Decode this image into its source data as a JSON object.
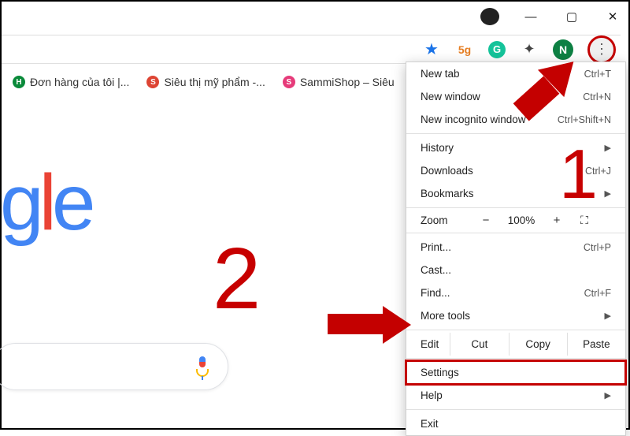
{
  "titlebar": {
    "min": "—",
    "max": "▢",
    "close": "✕"
  },
  "addrbar": {
    "star": "★",
    "avatar_letter": "N"
  },
  "bookmarks": [
    {
      "icon_class": "fv-green",
      "icon_text": "H",
      "label": "Đơn hàng của tôi |..."
    },
    {
      "icon_class": "fv-red",
      "icon_text": "S",
      "label": "Siêu thị mỹ phẩm -..."
    },
    {
      "icon_class": "fv-pink",
      "icon_text": "S",
      "label": "SammiShop – Siêu"
    }
  ],
  "menu": {
    "new_tab": {
      "label": "New tab",
      "shortcut": "Ctrl+T"
    },
    "new_window": {
      "label": "New window",
      "shortcut": "Ctrl+N"
    },
    "incognito": {
      "label": "New incognito window",
      "shortcut": "Ctrl+Shift+N"
    },
    "history": {
      "label": "History"
    },
    "downloads": {
      "label": "Downloads",
      "shortcut": "Ctrl+J"
    },
    "bookmarks": {
      "label": "Bookmarks"
    },
    "zoom": {
      "label": "Zoom",
      "level": "100%"
    },
    "print": {
      "label": "Print...",
      "shortcut": "Ctrl+P"
    },
    "cast": {
      "label": "Cast..."
    },
    "find": {
      "label": "Find...",
      "shortcut": "Ctrl+F"
    },
    "more_tools": {
      "label": "More tools"
    },
    "edit": {
      "label": "Edit",
      "cut": "Cut",
      "copy": "Copy",
      "paste": "Paste"
    },
    "settings": {
      "label": "Settings"
    },
    "help": {
      "label": "Help"
    },
    "exit": {
      "label": "Exit"
    }
  },
  "annotations": {
    "one": "1",
    "two": "2"
  },
  "google": [
    "g",
    "l",
    "e"
  ]
}
